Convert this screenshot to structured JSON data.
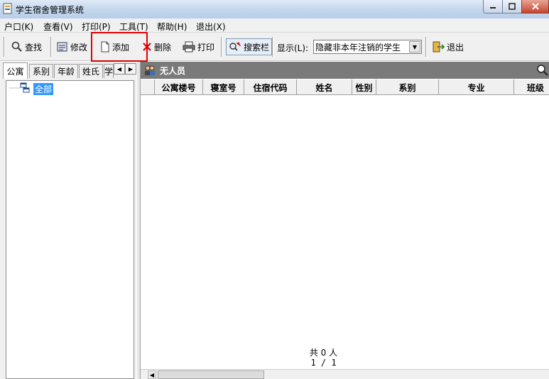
{
  "window": {
    "title": "学生宿舍管理系统"
  },
  "menu": [
    "户口(K)",
    "查看(V)",
    "打印(P)",
    "工具(T)",
    "帮助(H)",
    "退出(X)"
  ],
  "toolbar": {
    "find": "查找",
    "edit": "修改",
    "add": "添加",
    "delete": "删除",
    "print": "打印",
    "search_bar": "搜索栏",
    "display_label": "显示(L):",
    "display_value": "隐藏非本年注销的学生",
    "exit": "退出"
  },
  "left_tabs": [
    "公寓",
    "系别",
    "年龄",
    "姓氏",
    "学"
  ],
  "tree": {
    "root": "全部"
  },
  "right_header": {
    "title": "无人员"
  },
  "grid": {
    "columns": [
      "公寓楼号",
      "寝室号",
      "住宿代码",
      "姓名",
      "性别",
      "系别",
      "专业",
      "班级"
    ]
  },
  "footer": {
    "count": "共 0 人",
    "page": "1 / 1"
  },
  "colors": {
    "highlight": "#e00000",
    "selection": "#3399ff",
    "header_bg": "#7a7a7a"
  }
}
